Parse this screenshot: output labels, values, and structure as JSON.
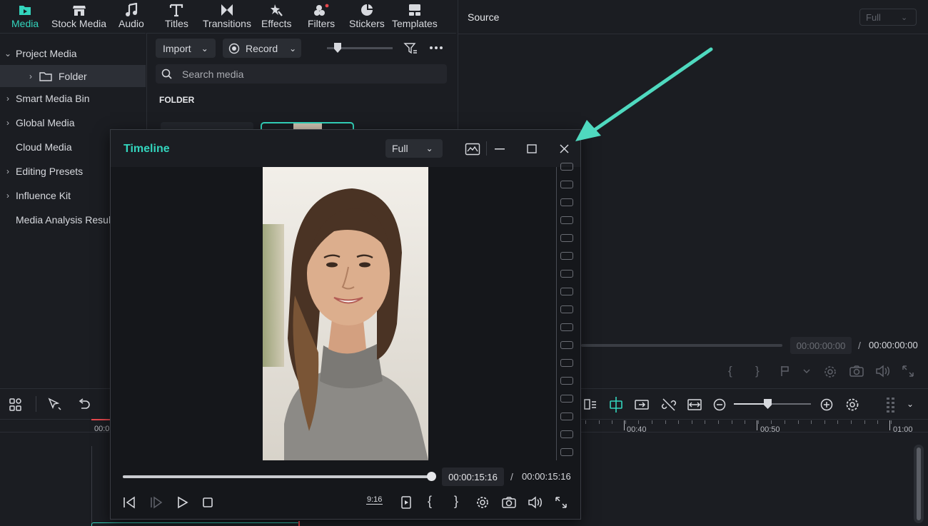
{
  "toolbar": {
    "tabs": [
      {
        "label": "Media",
        "icon": "media-icon",
        "active": true
      },
      {
        "label": "Stock Media",
        "icon": "stock-media-icon"
      },
      {
        "label": "Audio",
        "icon": "audio-icon"
      },
      {
        "label": "Titles",
        "icon": "titles-icon"
      },
      {
        "label": "Transitions",
        "icon": "transitions-icon"
      },
      {
        "label": "Effects",
        "icon": "effects-icon"
      },
      {
        "label": "Filters",
        "icon": "filters-icon"
      },
      {
        "label": "Stickers",
        "icon": "stickers-icon"
      },
      {
        "label": "Templates",
        "icon": "templates-icon"
      }
    ]
  },
  "tree": {
    "items": [
      {
        "label": "Project Media",
        "chevron": "down"
      },
      {
        "label": "Folder",
        "chevron": "right"
      },
      {
        "label": "Smart Media Bin",
        "chevron": "right"
      },
      {
        "label": "Global Media",
        "chevron": "right"
      },
      {
        "label": "Cloud Media",
        "chevron": ""
      },
      {
        "label": "Editing Presets",
        "chevron": "right"
      },
      {
        "label": "Influence Kit",
        "chevron": "right"
      },
      {
        "label": "Media Analysis Results",
        "chevron": ""
      }
    ]
  },
  "media": {
    "import_label": "Import",
    "record_label": "Record",
    "search_placeholder": "Search media",
    "folder_heading": "FOLDER"
  },
  "source": {
    "title": "Source",
    "zoom_select": "Full",
    "current_time": "00:00:00:00",
    "separator": "/",
    "total_time": "00:00:00:00"
  },
  "timeline": {
    "ruler": [
      "00:0",
      "00:40",
      "00:50",
      "01:00"
    ]
  },
  "window": {
    "title": "Timeline",
    "zoom_select": "Full",
    "current_time": "00:00:15:16",
    "separator": "/",
    "total_time": "00:00:15:16",
    "aspect_label": "9:16",
    "progress": 1.0
  },
  "colors": {
    "accent": "#33d5bd",
    "arrow": "#4fd9bf",
    "bg": "#1b1d22"
  }
}
